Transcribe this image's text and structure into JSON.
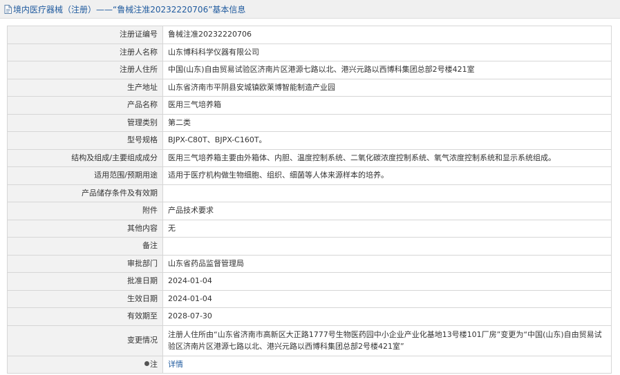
{
  "header": {
    "title": "境内医疗器械（注册）——“鲁械注准20232220706”基本信息"
  },
  "rows": [
    {
      "label": "注册证编号",
      "value": "鲁械注准20232220706"
    },
    {
      "label": "注册人名称",
      "value": "山东博科科学仪器有限公司"
    },
    {
      "label": "注册人住所",
      "value": "中国(山东)自由贸易试验区济南片区港源七路以北、港兴元路以西博科集团总部2号楼421室"
    },
    {
      "label": "生产地址",
      "value": "山东省济南市平阴县安城镇欧莱博智能制造产业园"
    },
    {
      "label": "产品名称",
      "value": "医用三气培养箱"
    },
    {
      "label": "管理类别",
      "value": "第二类"
    },
    {
      "label": "型号规格",
      "value": "BJPX-C80T、BJPX-C160T。"
    },
    {
      "label": "结构及组成/主要组成成分",
      "value": "医用三气培养箱主要由外箱体、内胆、温度控制系统、二氧化碳浓度控制系统、氧气浓度控制系统和显示系统组成。"
    },
    {
      "label": "适用范围/预期用途",
      "value": "适用于医疗机构做生物细胞、组织、细菌等人体来源样本的培养。"
    },
    {
      "label": "产品储存条件及有效期",
      "value": ""
    },
    {
      "label": "附件",
      "value": "产品技术要求"
    },
    {
      "label": "其他内容",
      "value": "无"
    },
    {
      "label": "备注",
      "value": ""
    },
    {
      "label": "审批部门",
      "value": "山东省药品监督管理局"
    },
    {
      "label": "批准日期",
      "value": "2024-01-04"
    },
    {
      "label": "生效日期",
      "value": "2024-01-04"
    },
    {
      "label": "有效期至",
      "value": "2028-07-30"
    },
    {
      "label": "变更情况",
      "value": "注册人住所由“山东省济南市高新区大正路1777号生物医药园中小企业产业化基地13号楼101厂房”变更为“中国(山东)自由贸易试验区济南片区港源七路以北、港兴元路以西博科集团总部2号楼421室”"
    }
  ],
  "note_row": {
    "label": "注",
    "icon": "note-icon",
    "link_text": "详情"
  },
  "colors": {
    "header_text": "#1f5a9e",
    "label_bg": "#f2f2f2",
    "border": "#d6d6d6",
    "link": "#1f5a9e"
  }
}
